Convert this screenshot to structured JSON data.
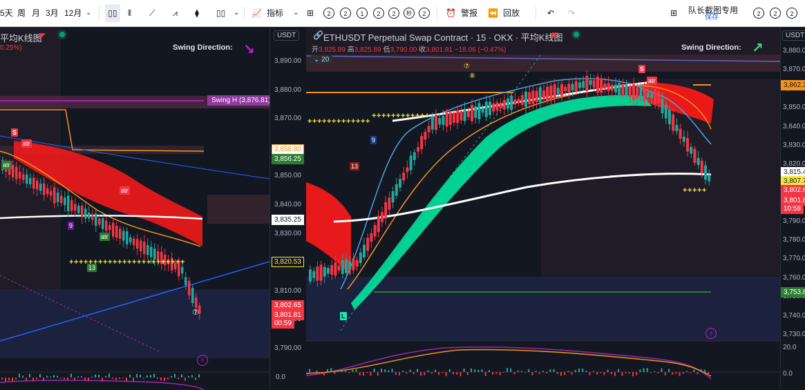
{
  "toolbar": {
    "intervals": [
      "5天",
      "周",
      "月",
      "3月",
      "12月"
    ],
    "indicators_label": "指标",
    "alert_label": "警报",
    "replay_label": "回放",
    "seconds_label": "秒",
    "badge_values": [
      "2",
      "2",
      "1",
      "2",
      "2",
      "2"
    ],
    "right_title": "队长截图专用",
    "right_subtitle": "保存",
    "right_badges": [
      "2",
      "2",
      "2"
    ]
  },
  "left_pane": {
    "title": "平均K线图",
    "change": "0.25%)",
    "swing_direction": "Swing Direction:",
    "swing_h_label": "Swing H (3,876.81)",
    "currency": "USDT",
    "y_ticks": [
      "3,890.00",
      "3,880.00",
      "3,870.00",
      "3,860.00",
      "3,850.00",
      "3,840.00",
      "3,830.00",
      "3,820.00",
      "3,810.00",
      "3,800.00",
      "3,790.00"
    ],
    "bottom_tick": "0.0",
    "price_labels": [
      {
        "value": "3,858.80",
        "bg": "#ffffff",
        "fg": "#f7931a",
        "border": "#f7931a"
      },
      {
        "value": "3,856.25",
        "bg": "#2e7d32",
        "fg": "#ffffff",
        "border": "#2e7d32"
      },
      {
        "value": "3,835.25",
        "bg": "#ffffff",
        "fg": "#131722",
        "border": "#ffffff"
      },
      {
        "value": "3,820.53",
        "bg": "#131722",
        "fg": "#f5e642",
        "border": "#f5e642"
      },
      {
        "value": "3,802.65",
        "bg": "#f23645",
        "fg": "#ffffff",
        "border": "#f23645"
      },
      {
        "value": "3,801.81",
        "bg": "#f23645",
        "fg": "#ffffff",
        "border": "#f23645"
      },
      {
        "value": "00:59",
        "bg": "#f23645",
        "fg": "#ffffff",
        "border": "#f23645"
      }
    ],
    "signals": [
      "S",
      "atr",
      "atr",
      "atr",
      "atr",
      "9",
      "13",
      "⑦"
    ]
  },
  "right_pane": {
    "title": "ETHUSDT Perpetual Swap Contract · 15 · OKX · 平均K线图",
    "ohlc": {
      "open_label": "开",
      "open": "3,825.89",
      "high_label": "高",
      "high": "3,825.89",
      "low_label": "低",
      "low": "3,790.00",
      "close_label": "收",
      "close": "3,801.81",
      "change": "−18.06 (−0.47%)"
    },
    "bars_count": "20",
    "swing_direction": "Swing Direction:",
    "currency": "USDT",
    "y_ticks": [
      "3,880.00",
      "3,870.00",
      "3,860.00",
      "3,850.00",
      "3,840.00",
      "3,830.00",
      "3,820.00",
      "3,810.00",
      "3,800.00",
      "3,790.00",
      "3,780.00",
      "3,770.00",
      "3,760.00",
      "3,750.00",
      "3,740.00",
      "3,730.00"
    ],
    "osc_ticks": [
      "20.0",
      "0.0"
    ],
    "price_labels": [
      {
        "value": "3,862.3",
        "bg": "#f7931a",
        "fg": "#131722",
        "border": "#f7931a"
      },
      {
        "value": "3,815.4",
        "bg": "#ffffff",
        "fg": "#131722",
        "border": "#ffffff"
      },
      {
        "value": "3,807.7",
        "bg": "#f5e642",
        "fg": "#131722",
        "border": "#f5e642"
      },
      {
        "value": "3,802.6",
        "bg": "#f23645",
        "fg": "#ffffff",
        "border": "#f23645"
      },
      {
        "value": "3,801.8",
        "bg": "#f23645",
        "fg": "#ffffff",
        "border": "#f23645"
      },
      {
        "value": "10:58",
        "bg": "#f23645",
        "fg": "#ffffff",
        "border": "#f23645"
      },
      {
        "value": "3,753.8",
        "bg": "#2e7d32",
        "fg": "#ffffff",
        "border": "#2e7d32"
      }
    ],
    "signals": [
      "S",
      "atr",
      "9",
      "13",
      "L",
      "⑦",
      "⑧"
    ]
  },
  "colors": {
    "up": "#26a69a",
    "down": "#f23645",
    "ema": "#f7931a",
    "white_line": "#ffffff",
    "green_cloud": "#00e6a0",
    "red_cloud": "#ff1a1a",
    "purple": "#9c27b0"
  }
}
